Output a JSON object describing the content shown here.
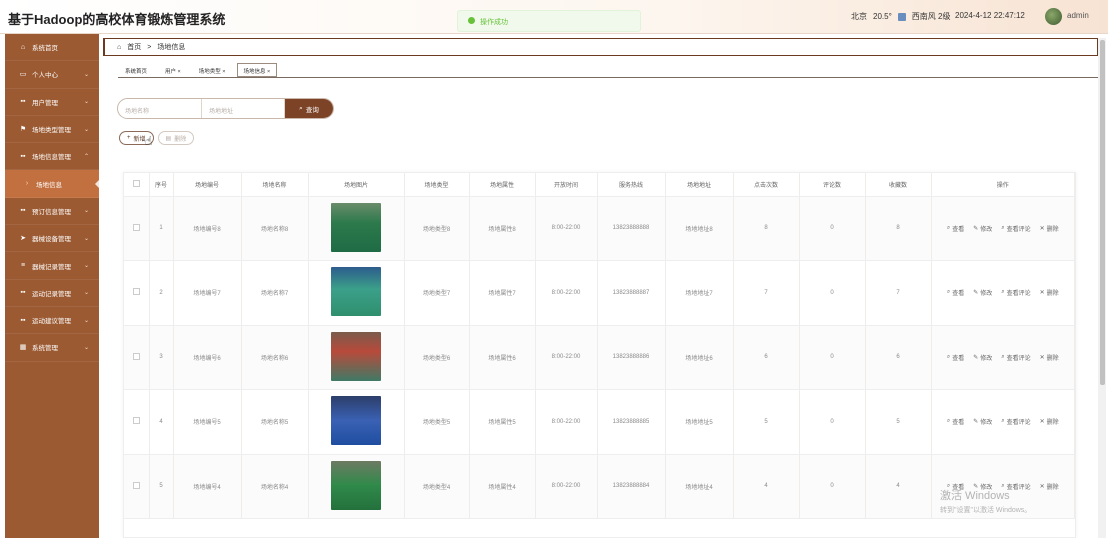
{
  "header": {
    "title": "基于Hadoop的高校体育锻炼管理系统",
    "toast": "操作成功",
    "weather": {
      "city": "北京",
      "temp": "20.5°",
      "wind": "西南风 2级"
    },
    "datetime": "2024-4-12 22:47:12",
    "user": "admin"
  },
  "sidebar": {
    "items": [
      {
        "label": "系统首页",
        "icon": "home-icon"
      },
      {
        "label": "个人中心",
        "icon": "profile-icon"
      },
      {
        "label": "用户管理",
        "icon": "grid-icon"
      },
      {
        "label": "场地类型管理",
        "icon": "flag-icon"
      },
      {
        "label": "场地信息管理",
        "icon": "grid-icon"
      },
      {
        "label": "场地信息",
        "icon": "arrow-icon",
        "active": true
      },
      {
        "label": "预订信息管理",
        "icon": "grid-icon"
      },
      {
        "label": "器械设备管理",
        "icon": "send-icon"
      },
      {
        "label": "器械记录管理",
        "icon": "list-icon"
      },
      {
        "label": "运动记录管理",
        "icon": "grid-icon"
      },
      {
        "label": "运动建议管理",
        "icon": "grid-icon"
      },
      {
        "label": "系统管理",
        "icon": "table-icon"
      }
    ]
  },
  "breadcrumb": {
    "home": "首页",
    "current": "场地信息"
  },
  "tabs": [
    {
      "label": "系统首页"
    },
    {
      "label": "用户 ×"
    },
    {
      "label": "场地类型 ×"
    },
    {
      "label": "场地信息 ×",
      "current": true
    }
  ],
  "search": {
    "name_placeholder": "场地名称",
    "address_placeholder": "场地地址",
    "button": "查询"
  },
  "actions": {
    "add": "新增",
    "delete": "删除"
  },
  "table": {
    "headers": [
      "序号",
      "场地编号",
      "场地名称",
      "场地图片",
      "场地类型",
      "场地属性",
      "开放时间",
      "服务热线",
      "场地地址",
      "点击次数",
      "评论数",
      "收藏数",
      "操作"
    ],
    "ops": {
      "view": "查看",
      "edit": "修改",
      "comments": "查看评论",
      "delete": "删除"
    },
    "rows": [
      {
        "no": "1",
        "code": "场地编号8",
        "name": "场地名称8",
        "type": "场地类型8",
        "attr": "场地属性8",
        "hours": "8:00-22:00",
        "phone": "13823888888",
        "addr": "场地地址8",
        "clicks": "8",
        "comments": "0",
        "favs": "8"
      },
      {
        "no": "2",
        "code": "场地编号7",
        "name": "场地名称7",
        "type": "场地类型7",
        "attr": "场地属性7",
        "hours": "8:00-22:00",
        "phone": "13823888887",
        "addr": "场地地址7",
        "clicks": "7",
        "comments": "0",
        "favs": "7"
      },
      {
        "no": "3",
        "code": "场地编号6",
        "name": "场地名称6",
        "type": "场地类型6",
        "attr": "场地属性6",
        "hours": "8:00-22:00",
        "phone": "13823888886",
        "addr": "场地地址6",
        "clicks": "6",
        "comments": "0",
        "favs": "6"
      },
      {
        "no": "4",
        "code": "场地编号5",
        "name": "场地名称5",
        "type": "场地类型5",
        "attr": "场地属性5",
        "hours": "8:00-22:00",
        "phone": "13823888885",
        "addr": "场地地址5",
        "clicks": "5",
        "comments": "0",
        "favs": "5"
      },
      {
        "no": "5",
        "code": "场地编号4",
        "name": "场地名称4",
        "type": "场地类型4",
        "attr": "场地属性4",
        "hours": "8:00-22:00",
        "phone": "13823888884",
        "addr": "场地地址4",
        "clicks": "4",
        "comments": "0",
        "favs": "4"
      }
    ]
  },
  "watermark": {
    "line1": "激活 Windows",
    "line2": "转到\"设置\"以激活 Windows。"
  },
  "colors": {
    "sidebar": "#9b5a32",
    "accent": "#7c4326",
    "active": "#c2703f"
  }
}
